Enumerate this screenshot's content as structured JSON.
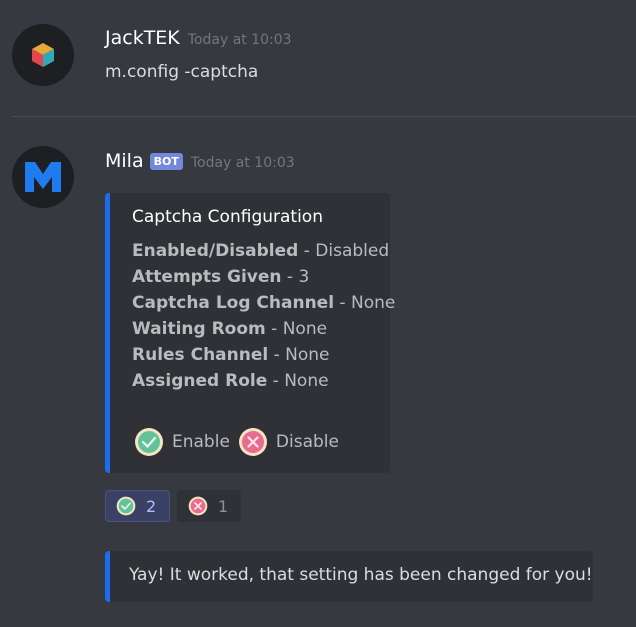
{
  "messages": [
    {
      "username": "JackTEK",
      "timestamp": "Today at 10:03",
      "content": "m.config -captcha",
      "avatar_icon": "cube-icon"
    },
    {
      "username": "Mila",
      "bot_tag": "BOT",
      "timestamp": "Today at 10:03",
      "avatar_icon": "m-logo-icon"
    }
  ],
  "embed": {
    "title": "Captcha Configuration",
    "accent_color": "#1d6cf0",
    "fields": [
      {
        "key": "Enabled/Disabled",
        "sep": " - ",
        "value": "Disabled"
      },
      {
        "key": "Attempts Given",
        "sep": " - ",
        "value": "3"
      },
      {
        "key": "Captcha Log Channel",
        "sep": " - ",
        "value": "None"
      },
      {
        "key": "Waiting Room",
        "sep": " - ",
        "value": "None"
      },
      {
        "key": "Rules Channel",
        "sep": " - ",
        "value": "None"
      },
      {
        "key": "Assigned Role",
        "sep": " - ",
        "value": "None"
      }
    ],
    "options": [
      {
        "icon": "check-emoji-icon",
        "label": "Enable"
      },
      {
        "icon": "cross-emoji-icon",
        "label": "Disable"
      }
    ]
  },
  "reactions": [
    {
      "icon": "check-emoji-icon",
      "count": "2",
      "active": true
    },
    {
      "icon": "cross-emoji-icon",
      "count": "1",
      "active": false
    }
  ],
  "embed2": {
    "description": "Yay! It worked, that setting has been changed for you!"
  }
}
